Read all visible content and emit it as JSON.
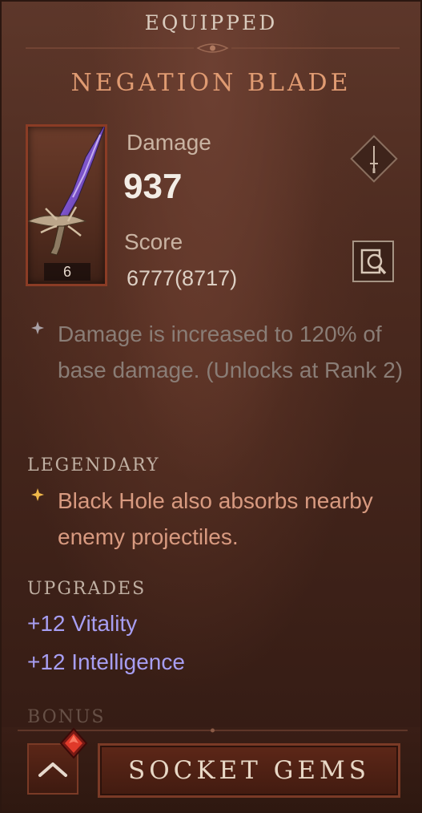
{
  "header": {
    "label": "EQUIPPED"
  },
  "item": {
    "name": "NEGATION BLADE",
    "level": "6",
    "damage_label": "Damage",
    "damage_value": "937",
    "score_label": "Score",
    "score_value": "6777(8717)"
  },
  "effects": {
    "inactive_text": "Damage is increased to 120% of base damage. (Unlocks at Rank 2)"
  },
  "legendary": {
    "heading": "LEGENDARY",
    "text": "Black Hole also absorbs nearby enemy projectiles."
  },
  "upgrades": {
    "heading": "UPGRADES",
    "items": [
      "+12 Vitality",
      "+12 Intelligence"
    ]
  },
  "bonus": {
    "heading": "BONUS"
  },
  "actions": {
    "socket_label": "SOCKET GEMS"
  },
  "colors": {
    "title": "#e09b72",
    "legendary_text": "#d89a80",
    "upgrade_text": "#a79ef2",
    "inactive_text": "#8a7d76"
  },
  "icons": {
    "weapon": "dagger-icon",
    "type": "sword-icon",
    "inspect": "inspect-icon",
    "up": "chevron-up-icon",
    "gem": "red-gem-icon"
  }
}
